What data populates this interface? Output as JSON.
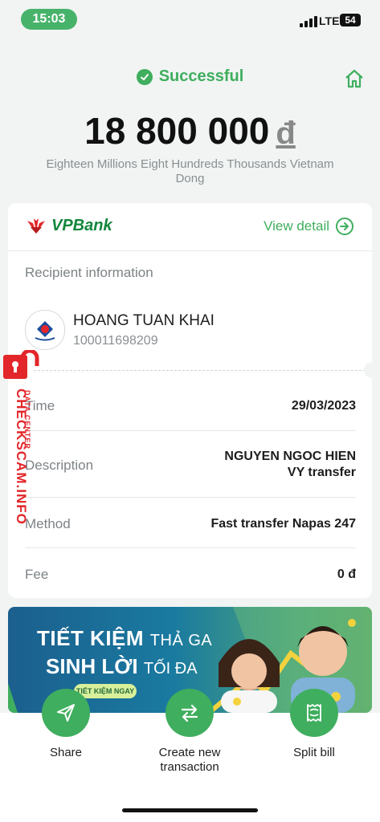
{
  "status_bar": {
    "time": "15:03",
    "network": "LTE",
    "battery": "54"
  },
  "header": {
    "status_text": "Successful",
    "amount": "18 800 000",
    "currency": "đ",
    "amount_words": "Eighteen Millions Eight Hundreds Thousands Vietnam Dong"
  },
  "card": {
    "bank_name": "VPBank",
    "view_detail": "View detail",
    "recipient_label": "Recipient information",
    "recipient_name": "HOANG TUAN KHAI",
    "recipient_account": "100011698209",
    "rows": [
      {
        "label": "Time",
        "value": "29/03/2023"
      },
      {
        "label": "Description",
        "value_line1": "NGUYEN NGOC HIEN",
        "value_line2": "VY transfer"
      },
      {
        "label": "Method",
        "value": "Fast transfer Napas 247"
      },
      {
        "label": "Fee",
        "value": "0 đ"
      }
    ]
  },
  "banner": {
    "line1_big": "TIẾT KIỆM",
    "line1_small": "THẢ GA",
    "line2_big": "SINH LỜI",
    "line2_small": "TỐI ĐA",
    "button": "TIẾT KIỆM NGAY"
  },
  "actions": [
    {
      "label": "Share"
    },
    {
      "label_line1": "Create new",
      "label_line2": "transaction"
    },
    {
      "label": "Split bill"
    }
  ],
  "watermark": {
    "site": "CHECKSCAM.INFO",
    "sub": "DATA CENTER"
  },
  "colors": {
    "accent": "#3fae5e",
    "brand_green": "#12863c",
    "brand_red": "#e3262a"
  }
}
